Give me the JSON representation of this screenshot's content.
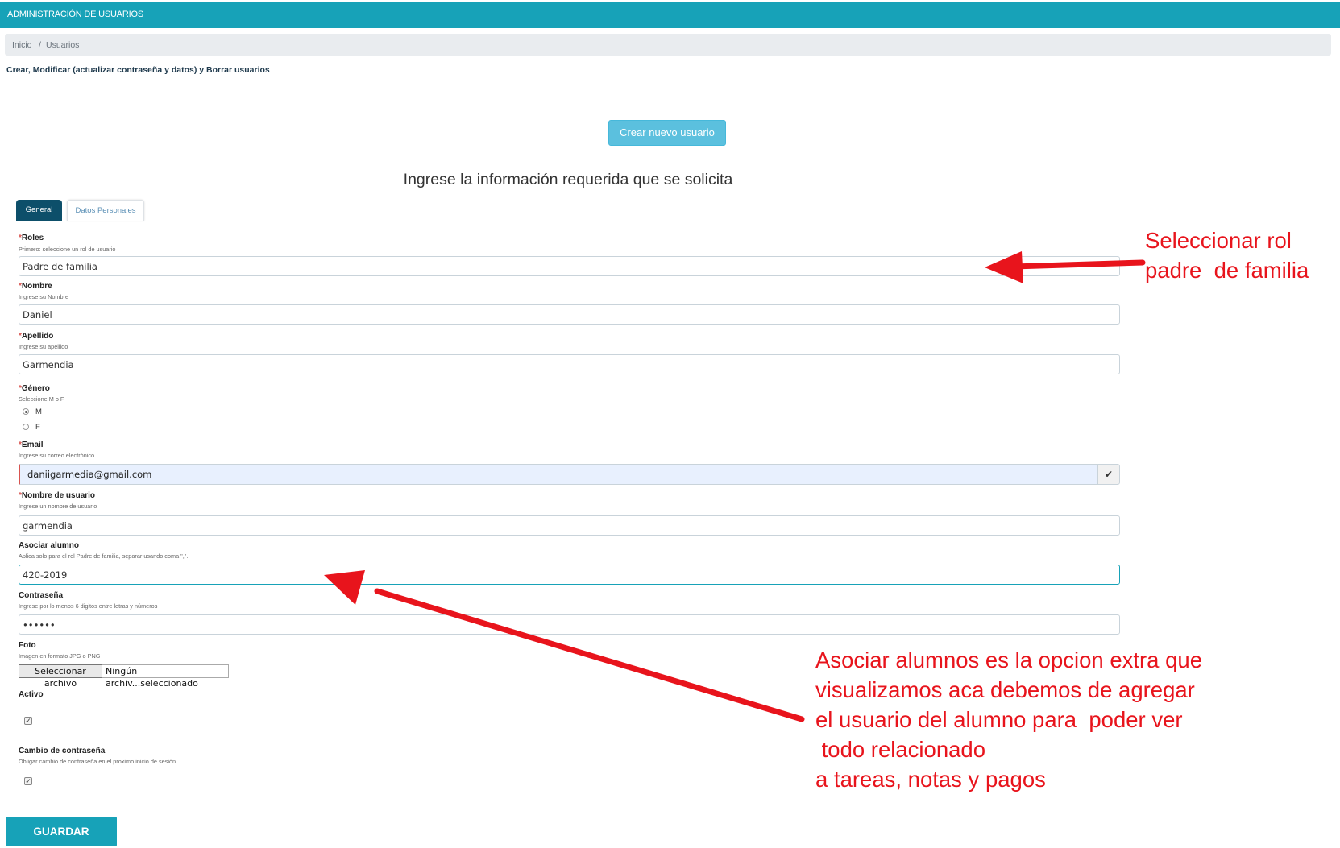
{
  "header": {
    "title": "ADMINISTRACIÓN DE USUARIOS"
  },
  "breadcrumb": {
    "home": "Inicio",
    "separator": "/",
    "current": "Usuarios"
  },
  "page": {
    "description": "Crear, Modificar (actualizar contraseña y datos) y Borrar usuarios",
    "create_button": "Crear nuevo usuario",
    "form_heading": "Ingrese la información requerida que se solicita"
  },
  "tabs": [
    {
      "label": "General",
      "active": true
    },
    {
      "label": "Datos Personales",
      "active": false
    }
  ],
  "form": {
    "required_mark": "*",
    "roles": {
      "label": "Roles",
      "hint": "Primero: seleccione un rol de usuario",
      "value": "Padre de familia"
    },
    "nombre": {
      "label": "Nombre",
      "hint": "Ingrese su Nombre",
      "value": "Daniel"
    },
    "apellido": {
      "label": "Apellido",
      "hint": "Ingrese su apellido",
      "value": "Garmendia"
    },
    "genero": {
      "label": "Género",
      "hint": "Seleccione M o F",
      "options": [
        "M",
        "F"
      ],
      "selected": "M"
    },
    "email": {
      "label": "Email",
      "hint": "Ingrese su correo electrónico",
      "value": "daniigarmedia@gmail.com",
      "addon_icon": "check-icon"
    },
    "username": {
      "label": "Nombre de usuario",
      "hint": "Ingrese un nombre de usuario",
      "value": "garmendia"
    },
    "asociar": {
      "label": "Asociar alumno",
      "hint": "Aplica solo para el rol Padre de familia, separar usando coma \",\".",
      "value": "420-2019"
    },
    "password": {
      "label": "Contraseña",
      "hint": "Ingrese por lo menos 6 digitos entre letras y números",
      "value": "••••••"
    },
    "foto": {
      "label": "Foto",
      "hint": "Imagen en formato JPG o PNG",
      "button": "Seleccionar archivo",
      "file_text": "Ningún archiv...seleccionado"
    },
    "activo": {
      "label": "Activo",
      "checked": true
    },
    "cambio": {
      "label": "Cambio de contraseña",
      "hint": "Obligar cambio de contraseña en el proximo inicio de sesión",
      "checked": true
    },
    "save_button": "GUARDAR"
  },
  "annotations": {
    "roles_note": [
      "Seleccionar rol",
      "padre  de familia"
    ],
    "asociar_note": [
      "Asociar alumnos es la opcion extra que",
      "visualizamos aca debemos de agregar",
      "el usuario del alumno para  poder ver",
      " todo relacionado",
      "a tareas, notas y pagos"
    ],
    "color": "#e8141c"
  },
  "colors": {
    "accent": "#17a2b8",
    "tab_active": "#0d4f6a",
    "create_button": "#5bc0de",
    "required": "#d9534f"
  }
}
